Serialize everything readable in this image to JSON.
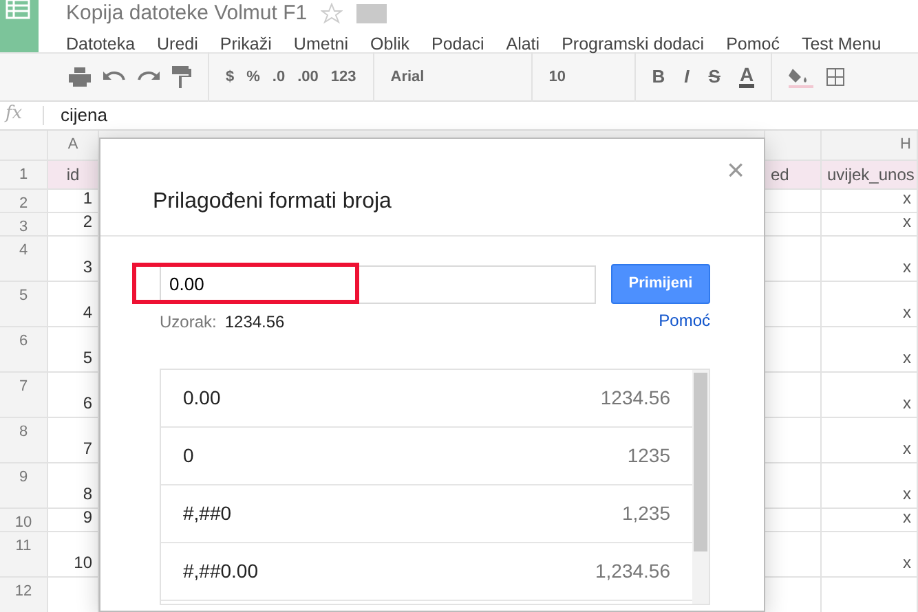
{
  "document_title": "Kopija datoteke Volmut F1",
  "menu": [
    "Datoteka",
    "Uredi",
    "Prikaži",
    "Umetni",
    "Oblik",
    "Podaci",
    "Alati",
    "Programski dodaci",
    "Pomoć",
    "Test Menu"
  ],
  "toolbar": {
    "currency": "$",
    "percent": "%",
    "decrease_decimals": ".0",
    "increase_decimals": ".00",
    "more_formats": "123",
    "font": "Arial",
    "font_size": "10",
    "bold": "B",
    "italic": "I",
    "strikethrough": "S",
    "text_color": "A"
  },
  "formula_bar": {
    "label": "fx",
    "value": "cijena"
  },
  "grid": {
    "column_a": {
      "header": "A",
      "cell": "id"
    },
    "column_partial": {
      "cell": "ed"
    },
    "column_h": {
      "header": "H",
      "cell": "uvijek_unos"
    },
    "rows": [
      {
        "number": "1",
        "a": "",
        "h": ""
      },
      {
        "number": "2",
        "a": "1",
        "h": "x"
      },
      {
        "number": "3",
        "a": "2",
        "h": "x"
      },
      {
        "number": "4",
        "a": "3",
        "h": "x"
      },
      {
        "number": "5",
        "a": "4",
        "h": "x"
      },
      {
        "number": "6",
        "a": "5",
        "h": "x"
      },
      {
        "number": "7",
        "a": "6",
        "h": "x"
      },
      {
        "number": "8",
        "a": "7",
        "h": "x"
      },
      {
        "number": "9",
        "a": "8",
        "h": "x"
      },
      {
        "number": "10",
        "a": "9",
        "h": "x"
      },
      {
        "number": "11",
        "a": "10",
        "h": "x"
      },
      {
        "number": "12",
        "a": "",
        "h": ""
      }
    ]
  },
  "dialog": {
    "title": "Prilagođeni formati broja",
    "close": "×",
    "input_value": "0.00",
    "apply_button": "Primijeni",
    "sample_label": "Uzorak:",
    "sample_value": "1234.56",
    "help_link": "Pomoć",
    "formats": [
      {
        "format": "0.00",
        "example": "1234.56"
      },
      {
        "format": "0",
        "example": "1235"
      },
      {
        "format": "#,##0",
        "example": "1,235"
      },
      {
        "format": "#,##0.00",
        "example": "1,234.56"
      }
    ]
  }
}
